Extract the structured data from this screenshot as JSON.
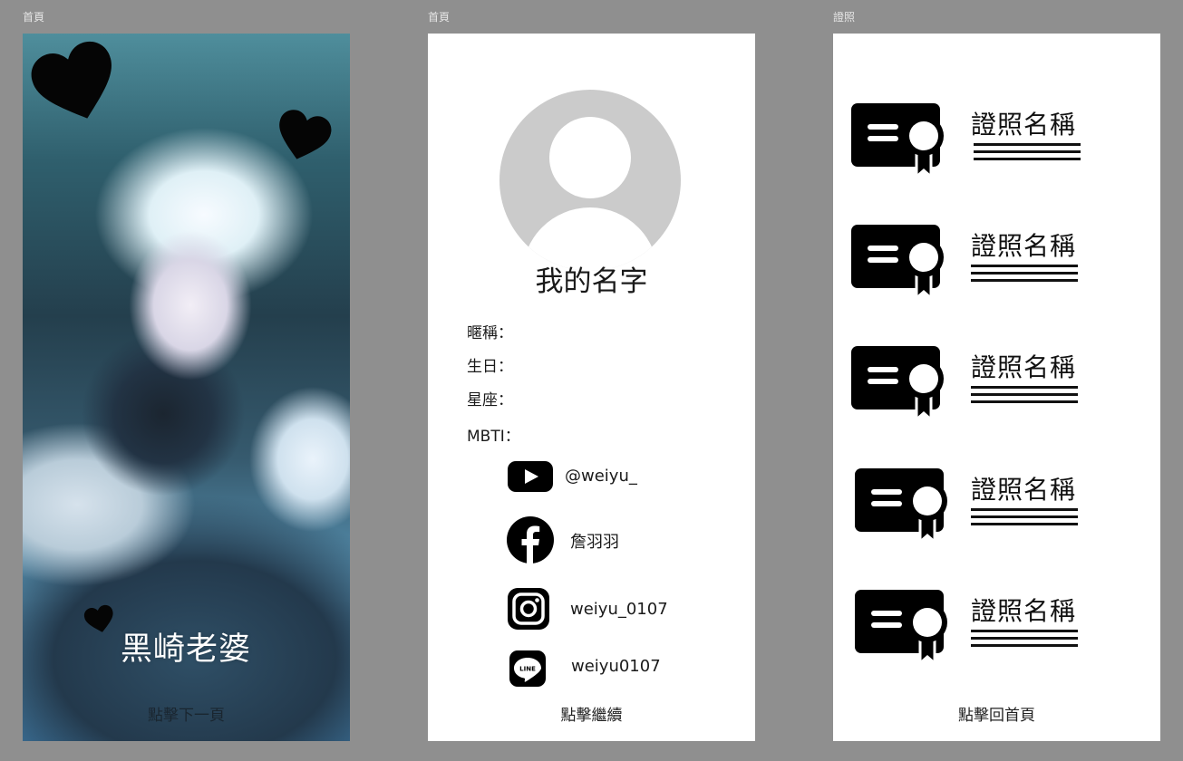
{
  "frames": [
    {
      "label": "首頁"
    },
    {
      "label": "首頁"
    },
    {
      "label": "證照"
    }
  ],
  "cover": {
    "title": "黑崎老婆",
    "next_link": "點擊下一頁",
    "photo": "portrait-photo",
    "decor_icon": "heart-icon"
  },
  "profile": {
    "avatar_icon": "user-avatar-icon",
    "name": "我的名字",
    "fields": [
      "暱稱：",
      "生日：",
      "星座：",
      "MBTI："
    ],
    "socials": [
      {
        "icon": "youtube-icon",
        "handle": "@weiyu_"
      },
      {
        "icon": "facebook-icon",
        "handle": "詹羽羽"
      },
      {
        "icon": "instagram-icon",
        "handle": "weiyu_0107"
      },
      {
        "icon": "line-icon",
        "handle": "weiyu0107"
      }
    ],
    "continue_link": "點擊繼續"
  },
  "certificates": {
    "icon": "certificate-icon",
    "items": [
      {
        "title": "證照名稱"
      },
      {
        "title": "證照名稱"
      },
      {
        "title": "證照名稱"
      },
      {
        "title": "證照名稱"
      },
      {
        "title": "證照名稱"
      }
    ],
    "home_link": "點擊回首頁"
  }
}
